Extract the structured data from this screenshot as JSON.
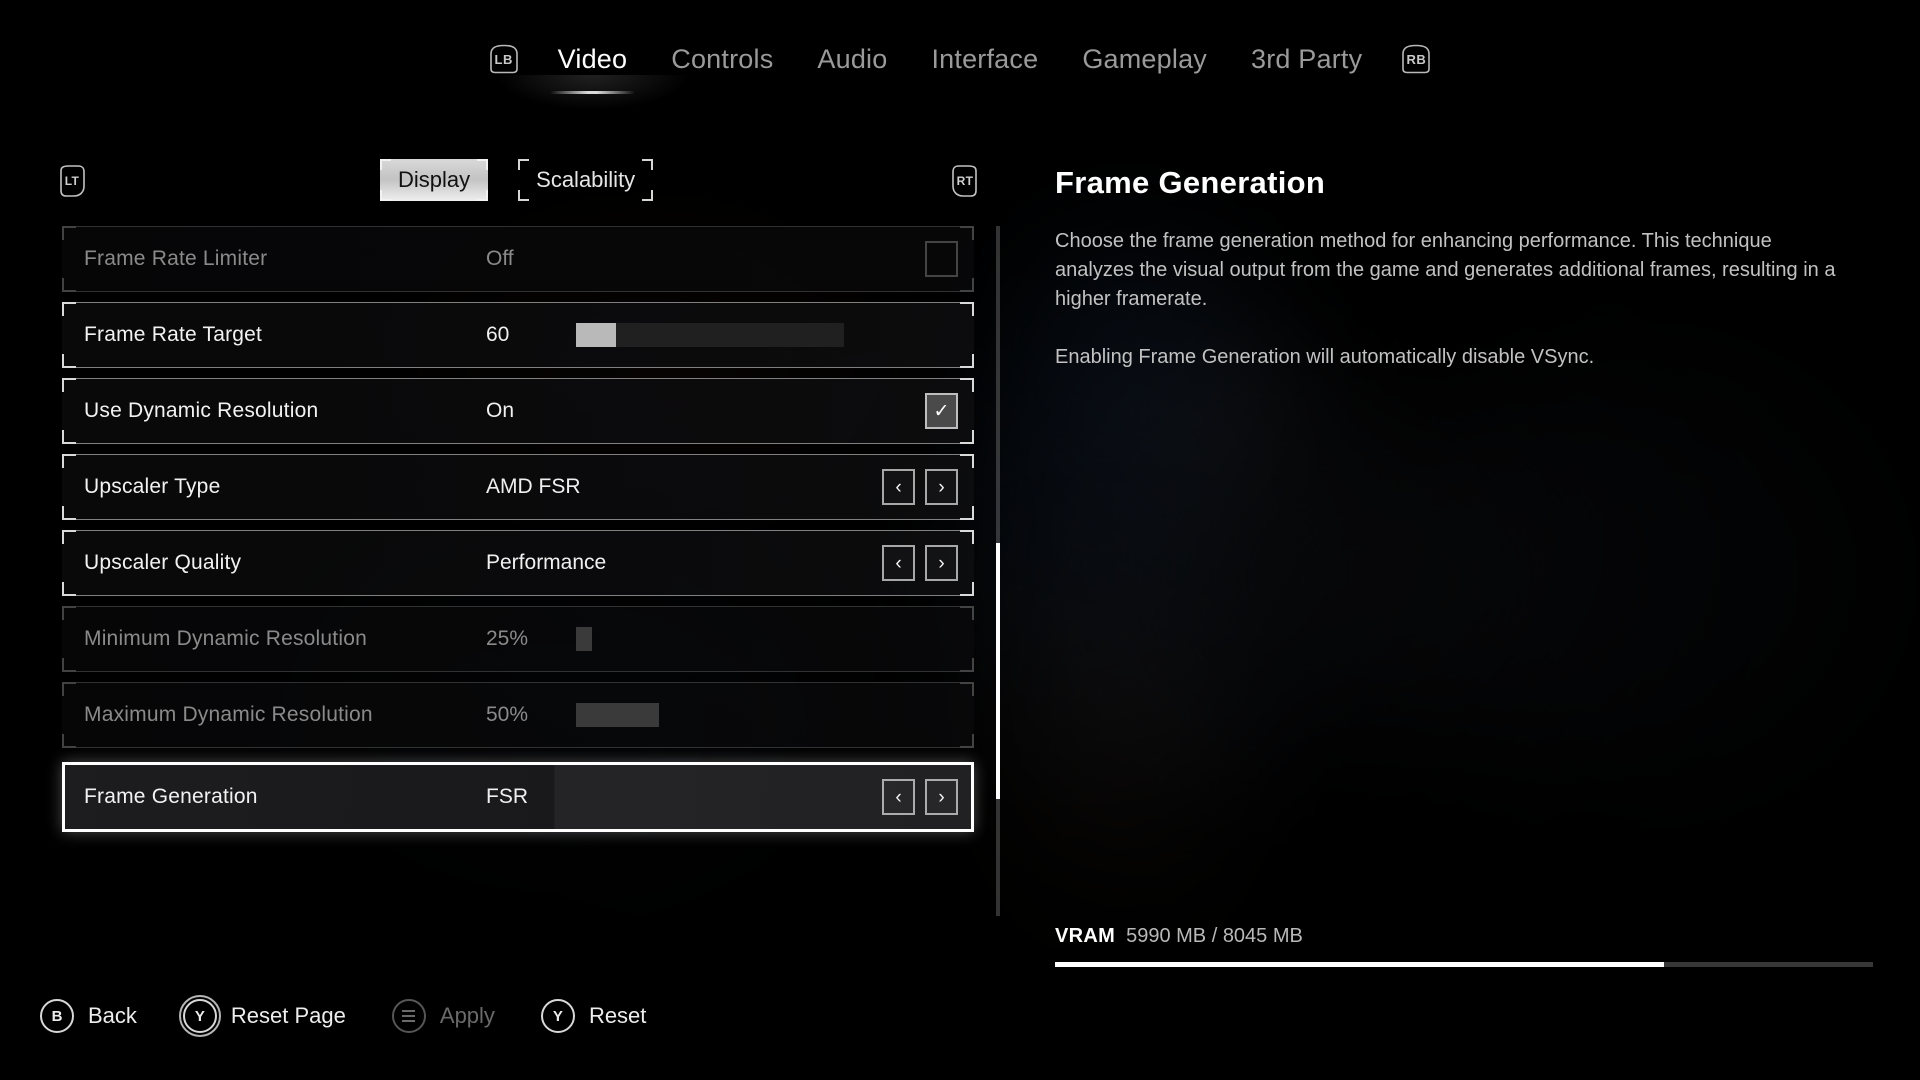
{
  "nav": {
    "left_bumper": "LB",
    "right_bumper": "RB",
    "tabs": [
      {
        "label": "Video",
        "active": true
      },
      {
        "label": "Controls",
        "active": false
      },
      {
        "label": "Audio",
        "active": false
      },
      {
        "label": "Interface",
        "active": false
      },
      {
        "label": "Gameplay",
        "active": false
      },
      {
        "label": "3rd Party",
        "active": false
      }
    ]
  },
  "subnav": {
    "left_trigger": "LT",
    "right_trigger": "RT",
    "tabs": [
      {
        "label": "Display",
        "selected": true
      },
      {
        "label": "Scalability",
        "selected": false
      }
    ]
  },
  "settings": [
    {
      "label": "Frame Rate Limiter",
      "value": "Off",
      "control": "checkbox",
      "checked": false,
      "state": "disabled"
    },
    {
      "label": "Frame Rate Target",
      "value": "60",
      "control": "slider",
      "fill_percent": 15,
      "state": "enabled"
    },
    {
      "label": "Use Dynamic Resolution",
      "value": "On",
      "control": "checkbox",
      "checked": true,
      "check_glyph": "✓",
      "state": "enabled"
    },
    {
      "label": "Upscaler Type",
      "value": "AMD FSR",
      "control": "stepper",
      "prev_glyph": "‹",
      "next_glyph": "›",
      "state": "enabled"
    },
    {
      "label": "Upscaler Quality",
      "value": "Performance",
      "control": "stepper",
      "prev_glyph": "‹",
      "next_glyph": "›",
      "state": "enabled"
    },
    {
      "label": "Minimum Dynamic Resolution",
      "value": "25%",
      "control": "slider",
      "fill_percent": 6,
      "state": "disabled"
    },
    {
      "label": "Maximum Dynamic Resolution",
      "value": "50%",
      "control": "slider",
      "fill_percent": 31,
      "state": "disabled"
    },
    {
      "label": "Frame Generation",
      "value": "FSR",
      "control": "stepper",
      "prev_glyph": "‹",
      "next_glyph": "›",
      "state": "selected"
    }
  ],
  "scrollbar": {
    "thumb_top_percent": 46,
    "thumb_height_percent": 37
  },
  "detail": {
    "title": "Frame Generation",
    "paragraph1": "Choose the frame generation method for enhancing performance. This technique analyzes the visual output from the game and generates additional frames, resulting in a higher framerate.",
    "paragraph2": "Enabling Frame Generation will automatically disable VSync."
  },
  "vram": {
    "label": "VRAM",
    "value": "5990 MB / 8045 MB",
    "used_mb": 5990,
    "total_mb": 8045,
    "fill_percent": 74.5
  },
  "footer": [
    {
      "glyph": "B",
      "label": "Back",
      "style": "circle",
      "disabled": false
    },
    {
      "glyph": "Y",
      "label": "Reset Page",
      "style": "double-circle",
      "disabled": false
    },
    {
      "glyph": "menu",
      "label": "Apply",
      "style": "menu",
      "disabled": true
    },
    {
      "glyph": "Y",
      "label": "Reset",
      "style": "circle",
      "disabled": false
    }
  ],
  "colors": {
    "background": "#000000",
    "text_primary": "#f2f2f2",
    "text_dim": "#8a8a8a",
    "accent_white": "#ffffff",
    "slider_fill": "#b9b9b9"
  }
}
